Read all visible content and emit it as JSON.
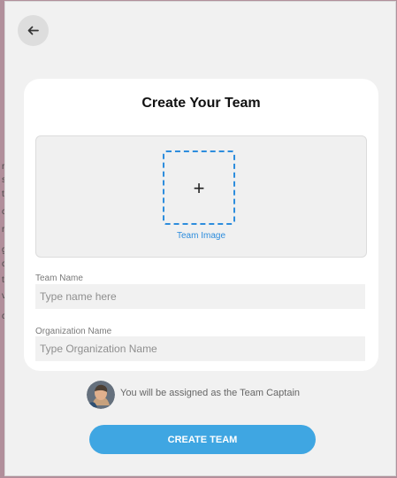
{
  "background": {
    "overlay_color": "#b18f9b",
    "side_text": [
      "r",
      "s",
      "t",
      "c",
      "r",
      "g",
      "c",
      "t",
      "v",
      "c"
    ]
  },
  "modal": {
    "background_color": "#f1f1f1",
    "back_button": {
      "icon": "arrow-left-icon",
      "accessible_label": "Back"
    }
  },
  "card": {
    "title": "Create Your Team",
    "upload": {
      "icon": "plus-icon",
      "plus_symbol": "+",
      "label": "Team Image",
      "accent_color": "#2d8ddd"
    },
    "team_name": {
      "label": "Team Name",
      "value": "",
      "placeholder": "Type name here"
    },
    "organization_name": {
      "label": "Organization Name",
      "value": "",
      "placeholder": "Type Organization Name"
    }
  },
  "captain": {
    "avatar": "captain-avatar",
    "text": "You will be assigned as the Team Captain"
  },
  "actions": {
    "create_team": "CREATE TEAM",
    "button_color": "#3fa6e2"
  }
}
